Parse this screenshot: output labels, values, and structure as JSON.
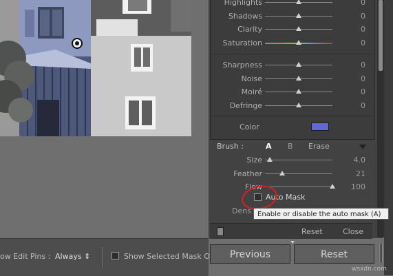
{
  "basic_sliders": [
    {
      "label": "Highlights",
      "value": "0",
      "pos": 0.5
    },
    {
      "label": "Shadows",
      "value": "0",
      "pos": 0.5
    },
    {
      "label": "Clarity",
      "value": "0",
      "pos": 0.5
    },
    {
      "label": "Saturation",
      "value": "0",
      "pos": 0.5
    }
  ],
  "detail_sliders": [
    {
      "label": "Sharpness",
      "value": "0",
      "pos": 0.5
    },
    {
      "label": "Noise",
      "value": "0",
      "pos": 0.5
    },
    {
      "label": "Moiré",
      "value": "0",
      "pos": 0.5
    },
    {
      "label": "Defringe",
      "value": "0",
      "pos": 0.5
    }
  ],
  "color": {
    "label": "Color",
    "swatch": "#6269c8"
  },
  "brush": {
    "label": "Brush :",
    "a": "A",
    "b": "B",
    "erase": "Erase",
    "sliders": [
      {
        "label": "Size",
        "value": "4.0",
        "pos": 0.07
      },
      {
        "label": "Feather",
        "value": "21",
        "pos": 0.25
      },
      {
        "label": "Flow",
        "value": "100",
        "pos": 1.0
      }
    ],
    "auto_mask_label": "Auto Mask",
    "density_label": "Dens"
  },
  "tooltip": "Enable or disable the auto mask (A)",
  "panel_footer": {
    "reset": "Reset",
    "close": "Close"
  },
  "bottom_buttons": {
    "previous": "Previous",
    "reset": "Reset"
  },
  "toolbar": {
    "edit_pins_label": "ow Edit Pins :",
    "edit_pins_value": "Always",
    "show_mask_label": "Show Selected Mask O"
  },
  "watermark": "wsxdn.com",
  "accent": "#d8201f"
}
